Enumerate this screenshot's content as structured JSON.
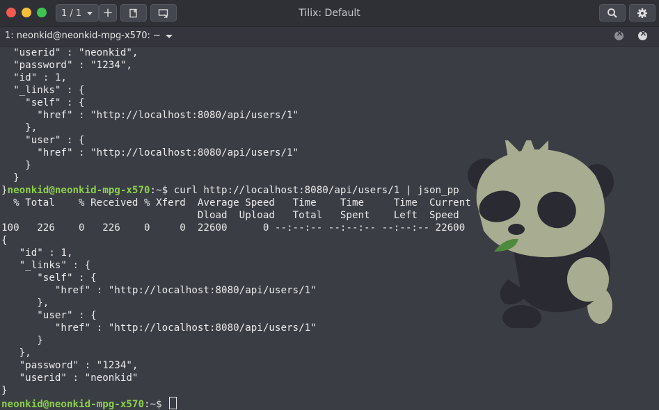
{
  "window": {
    "title": "Tilix: Default",
    "session_label": "1 / 1",
    "add_label": "+",
    "split_icon": "split-icon",
    "sync_icon": "sync-input-icon",
    "search_icon": "search-icon",
    "settings_icon": "gear-icon"
  },
  "tab": {
    "title": "1: neonkid@neonkid-mpg-x570: ~"
  },
  "terminal": {
    "lines_before": [
      "  \"userid\" : \"neonkid\",",
      "  \"password\" : \"1234\",",
      "  \"id\" : 1,",
      "  \"_links\" : {",
      "    \"self\" : {",
      "      \"href\" : \"http://localhost:8080/api/users/1\"",
      "    },",
      "    \"user\" : {",
      "      \"href\" : \"http://localhost:8080/api/users/1\"",
      "    }",
      "  }"
    ],
    "prompt_prefix": "}",
    "prompt": "neonkid@neonkid-mpg-x570",
    "prompt_path": ":~$ ",
    "command": "curl http://localhost:8080/api/users/1 | json_pp",
    "curl_header1": "  % Total    % Received % Xferd  Average Speed   Time    Time     Time  Current",
    "curl_header2": "                                 Dload  Upload   Total   Spent    Left  Speed",
    "curl_progress": "100   226    0   226    0     0  22600      0 --:--:-- --:--:-- --:--:-- 22600",
    "json_output": [
      "{",
      "   \"id\" : 1,",
      "   \"_links\" : {",
      "      \"self\" : {",
      "         \"href\" : \"http://localhost:8080/api/users/1\"",
      "      },",
      "      \"user\" : {",
      "         \"href\" : \"http://localhost:8080/api/users/1\"",
      "      }",
      "   },",
      "   \"password\" : \"1234\",",
      "   \"userid\" : \"neonkid\"",
      "}"
    ],
    "final_prompt": "neonkid@neonkid-mpg-x570",
    "final_path": ":~$ "
  },
  "colors": {
    "background": "#3b3d45",
    "prompt": "#8ad04a",
    "text": "#eaeaea"
  }
}
